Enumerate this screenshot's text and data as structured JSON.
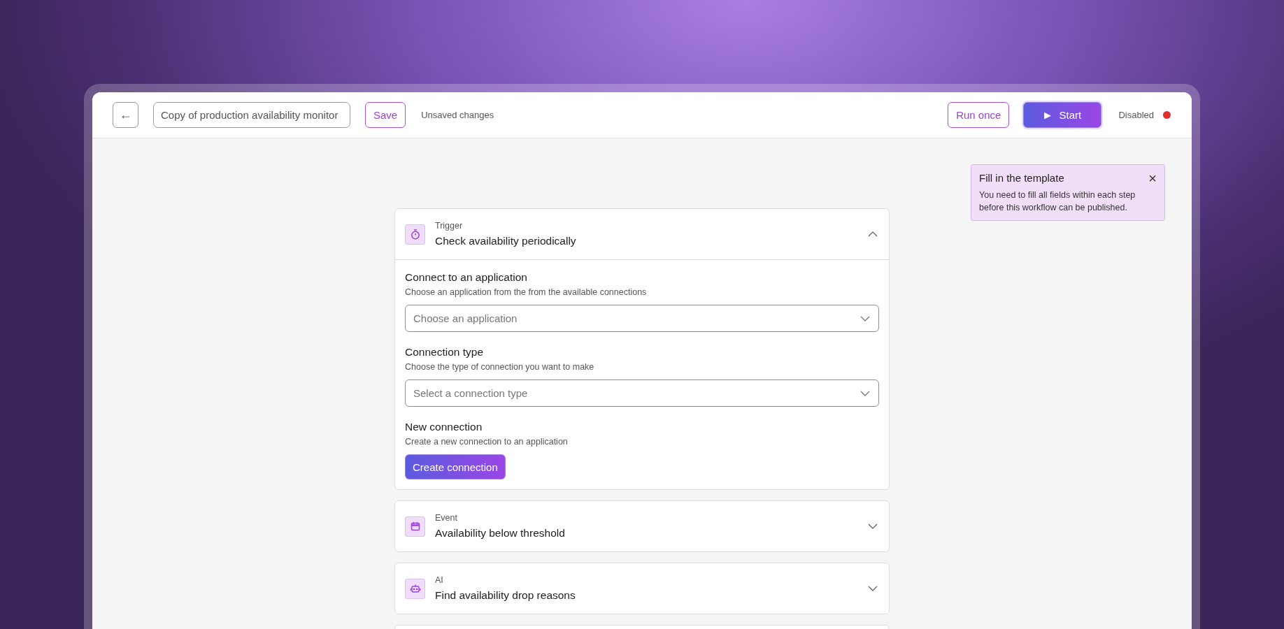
{
  "header": {
    "back_button": "←",
    "workflow_name": "Copy of production availability monitor",
    "save_button": "Save",
    "save_status": "Unsaved changes",
    "run_once_button": "Run once",
    "start_button": {
      "icon": "▶",
      "label": "Start"
    },
    "status": {
      "label": "Disabled",
      "color": "#e03131"
    }
  },
  "notice": {
    "title": "Fill in the template",
    "close": "×",
    "message": "You need to fill all fields within each step before this workflow can be published."
  },
  "steps": [
    {
      "kind": "timer",
      "category": "Trigger",
      "title": "Check availability periodically",
      "expanded": true,
      "sections": [
        {
          "kind": "select",
          "label": "Connect to an application",
          "description": "Choose an application from the from the available connections",
          "placeholder": "Choose an application"
        },
        {
          "kind": "select",
          "label": "Connection type",
          "description": "Choose the type of connection you want to make",
          "placeholder": "Select a connection type"
        },
        {
          "kind": "button",
          "label": "New connection",
          "description": "Create a new connection to an application",
          "button": "Create connection"
        }
      ]
    },
    {
      "kind": "calendar",
      "category": "Event",
      "title": "Availability below threshold",
      "expanded": false
    },
    {
      "kind": "robot",
      "category": "AI",
      "title": "Find availability drop reasons",
      "expanded": false
    },
    {
      "kind": "blank"
    }
  ]
}
